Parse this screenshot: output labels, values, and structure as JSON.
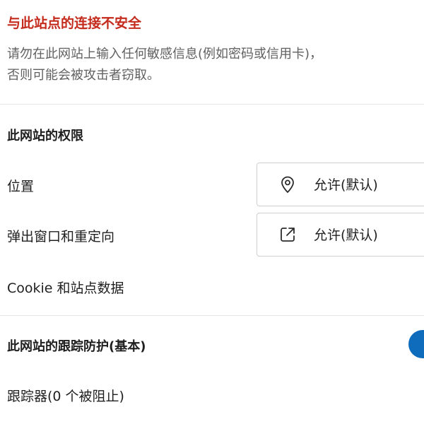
{
  "warning": {
    "title": "与此站点的连接不安全",
    "line1": "请勿在此网站上输入任何敏感信息(例如密码或信用卡)，",
    "line2": "否则可能会被攻击者窃取。"
  },
  "permissions": {
    "title": "此网站的权限",
    "items": [
      {
        "label": "位置",
        "value": "允许(默认)",
        "icon": "location-pin-icon"
      },
      {
        "label": "弹出窗口和重定向",
        "value": "允许(默认)",
        "icon": "external-link-icon"
      }
    ],
    "cookie_label": "Cookie 和站点数据"
  },
  "tracking": {
    "title": "此网站的跟踪防护(基本)",
    "enabled": true,
    "trackers_label": "跟踪器(0 个被阻止)"
  },
  "colors": {
    "warning_title": "#c42b1c",
    "toggle_on": "#0f6cbd"
  }
}
